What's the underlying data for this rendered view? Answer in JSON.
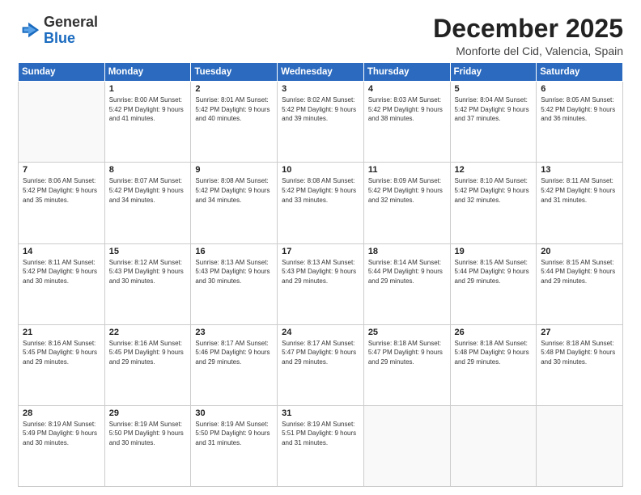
{
  "header": {
    "logo_general": "General",
    "logo_blue": "Blue",
    "month_title": "December 2025",
    "location": "Monforte del Cid, Valencia, Spain"
  },
  "weekdays": [
    "Sunday",
    "Monday",
    "Tuesday",
    "Wednesday",
    "Thursday",
    "Friday",
    "Saturday"
  ],
  "weeks": [
    [
      {
        "day": "",
        "info": ""
      },
      {
        "day": "1",
        "info": "Sunrise: 8:00 AM\nSunset: 5:42 PM\nDaylight: 9 hours\nand 41 minutes."
      },
      {
        "day": "2",
        "info": "Sunrise: 8:01 AM\nSunset: 5:42 PM\nDaylight: 9 hours\nand 40 minutes."
      },
      {
        "day": "3",
        "info": "Sunrise: 8:02 AM\nSunset: 5:42 PM\nDaylight: 9 hours\nand 39 minutes."
      },
      {
        "day": "4",
        "info": "Sunrise: 8:03 AM\nSunset: 5:42 PM\nDaylight: 9 hours\nand 38 minutes."
      },
      {
        "day": "5",
        "info": "Sunrise: 8:04 AM\nSunset: 5:42 PM\nDaylight: 9 hours\nand 37 minutes."
      },
      {
        "day": "6",
        "info": "Sunrise: 8:05 AM\nSunset: 5:42 PM\nDaylight: 9 hours\nand 36 minutes."
      }
    ],
    [
      {
        "day": "7",
        "info": "Sunrise: 8:06 AM\nSunset: 5:42 PM\nDaylight: 9 hours\nand 35 minutes."
      },
      {
        "day": "8",
        "info": "Sunrise: 8:07 AM\nSunset: 5:42 PM\nDaylight: 9 hours\nand 34 minutes."
      },
      {
        "day": "9",
        "info": "Sunrise: 8:08 AM\nSunset: 5:42 PM\nDaylight: 9 hours\nand 34 minutes."
      },
      {
        "day": "10",
        "info": "Sunrise: 8:08 AM\nSunset: 5:42 PM\nDaylight: 9 hours\nand 33 minutes."
      },
      {
        "day": "11",
        "info": "Sunrise: 8:09 AM\nSunset: 5:42 PM\nDaylight: 9 hours\nand 32 minutes."
      },
      {
        "day": "12",
        "info": "Sunrise: 8:10 AM\nSunset: 5:42 PM\nDaylight: 9 hours\nand 32 minutes."
      },
      {
        "day": "13",
        "info": "Sunrise: 8:11 AM\nSunset: 5:42 PM\nDaylight: 9 hours\nand 31 minutes."
      }
    ],
    [
      {
        "day": "14",
        "info": "Sunrise: 8:11 AM\nSunset: 5:42 PM\nDaylight: 9 hours\nand 30 minutes."
      },
      {
        "day": "15",
        "info": "Sunrise: 8:12 AM\nSunset: 5:43 PM\nDaylight: 9 hours\nand 30 minutes."
      },
      {
        "day": "16",
        "info": "Sunrise: 8:13 AM\nSunset: 5:43 PM\nDaylight: 9 hours\nand 30 minutes."
      },
      {
        "day": "17",
        "info": "Sunrise: 8:13 AM\nSunset: 5:43 PM\nDaylight: 9 hours\nand 29 minutes."
      },
      {
        "day": "18",
        "info": "Sunrise: 8:14 AM\nSunset: 5:44 PM\nDaylight: 9 hours\nand 29 minutes."
      },
      {
        "day": "19",
        "info": "Sunrise: 8:15 AM\nSunset: 5:44 PM\nDaylight: 9 hours\nand 29 minutes."
      },
      {
        "day": "20",
        "info": "Sunrise: 8:15 AM\nSunset: 5:44 PM\nDaylight: 9 hours\nand 29 minutes."
      }
    ],
    [
      {
        "day": "21",
        "info": "Sunrise: 8:16 AM\nSunset: 5:45 PM\nDaylight: 9 hours\nand 29 minutes."
      },
      {
        "day": "22",
        "info": "Sunrise: 8:16 AM\nSunset: 5:45 PM\nDaylight: 9 hours\nand 29 minutes."
      },
      {
        "day": "23",
        "info": "Sunrise: 8:17 AM\nSunset: 5:46 PM\nDaylight: 9 hours\nand 29 minutes."
      },
      {
        "day": "24",
        "info": "Sunrise: 8:17 AM\nSunset: 5:47 PM\nDaylight: 9 hours\nand 29 minutes."
      },
      {
        "day": "25",
        "info": "Sunrise: 8:18 AM\nSunset: 5:47 PM\nDaylight: 9 hours\nand 29 minutes."
      },
      {
        "day": "26",
        "info": "Sunrise: 8:18 AM\nSunset: 5:48 PM\nDaylight: 9 hours\nand 29 minutes."
      },
      {
        "day": "27",
        "info": "Sunrise: 8:18 AM\nSunset: 5:48 PM\nDaylight: 9 hours\nand 30 minutes."
      }
    ],
    [
      {
        "day": "28",
        "info": "Sunrise: 8:19 AM\nSunset: 5:49 PM\nDaylight: 9 hours\nand 30 minutes."
      },
      {
        "day": "29",
        "info": "Sunrise: 8:19 AM\nSunset: 5:50 PM\nDaylight: 9 hours\nand 30 minutes."
      },
      {
        "day": "30",
        "info": "Sunrise: 8:19 AM\nSunset: 5:50 PM\nDaylight: 9 hours\nand 31 minutes."
      },
      {
        "day": "31",
        "info": "Sunrise: 8:19 AM\nSunset: 5:51 PM\nDaylight: 9 hours\nand 31 minutes."
      },
      {
        "day": "",
        "info": ""
      },
      {
        "day": "",
        "info": ""
      },
      {
        "day": "",
        "info": ""
      }
    ]
  ]
}
